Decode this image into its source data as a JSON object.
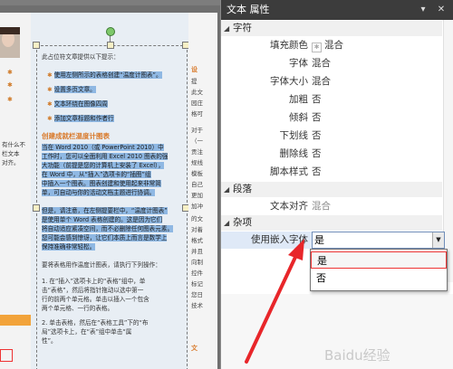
{
  "panel": {
    "title": "文本 属性",
    "controls": {
      "pin": "▾",
      "close": "✕"
    },
    "categories": {
      "character": "字符",
      "paragraph": "段落",
      "misc": "杂项"
    },
    "character_rows": [
      {
        "label": "填充颜色",
        "value": "混合",
        "has_swatch": true
      },
      {
        "label": "字体",
        "value": "混合"
      },
      {
        "label": "字体大小",
        "value": "混合"
      },
      {
        "label": "加粗",
        "value": "否"
      },
      {
        "label": "倾斜",
        "value": "否"
      },
      {
        "label": "下划线",
        "value": "否"
      },
      {
        "label": "删除线",
        "value": "否"
      },
      {
        "label": "脚本样式",
        "value": "否"
      }
    ],
    "paragraph_rows": [
      {
        "label": "文本对齐",
        "value": "混合"
      }
    ],
    "misc_rows": [
      {
        "label": "使用嵌入字体",
        "value": "是"
      }
    ],
    "dropdown_options": [
      "是",
      "否"
    ],
    "watermark": "Baidu经验"
  },
  "document": {
    "intro": "此占位符文章提供以下提示：",
    "bullets": [
      "使用左侧所示的表格创建“温度计图表”。",
      "设置多页文章。",
      "文本环绕在图像四周",
      "添加文章标题和作者行"
    ],
    "heading": "创建成就栏温度计图表",
    "paragraph1": [
      "当在 Word 2010（或 PowerPoint 2010）中",
      "工作时，您可以全面利用 Excel 2010 图表的强",
      "大功能（前提是您的计算机上安装了 Excel），",
      "在 Word 中，从“插入”选项卡的“插图”组",
      "中插入一个图表。图表创建和使用起来非常简",
      "单，可自动与你的活动文档主题进行协调。"
    ],
    "paragraph2": [
      "但是，请注意，在左侧提要栏中，“温度计图表”",
      "是使用单个 Word 表格创建的。这是因为它们",
      "将自动适应紧凑空间，而不必删除任何图表元素。",
      "您可能会感到惊讶，让它们本质上而言是数学上",
      "保持准确非常轻松。"
    ],
    "steps_intro": "要将表格用作温度计图表，请执行下列操作：",
    "steps": [
      "1.  在“插入”选项卡上的“表格”组中，单",
      "    击“表格”，然后将指针拖动以选中第一",
      "    行的前两个单元格。单击以插入一个包含",
      "    两个单元格、一行的表格。",
      "2.  单击表格，然后在“表格工具”下的“布",
      "    局”选项卡上，在“表”组中单击“属",
      "    性”。"
    ],
    "left_snippets": [
      "有什么不",
      "栏文本",
      "对齐。"
    ],
    "right_snippets": [
      "提",
      "此文",
      "园庄",
      "格可",
      "对于",
      "（一",
      "贡注",
      "规线",
      "模板",
      "自己",
      "更加",
      "加冲",
      "的文",
      "对着",
      "格式",
      "并且",
      "向制",
      "控件",
      "标记",
      "您日",
      "技术"
    ],
    "right_headings": [
      "设",
      "文"
    ]
  }
}
